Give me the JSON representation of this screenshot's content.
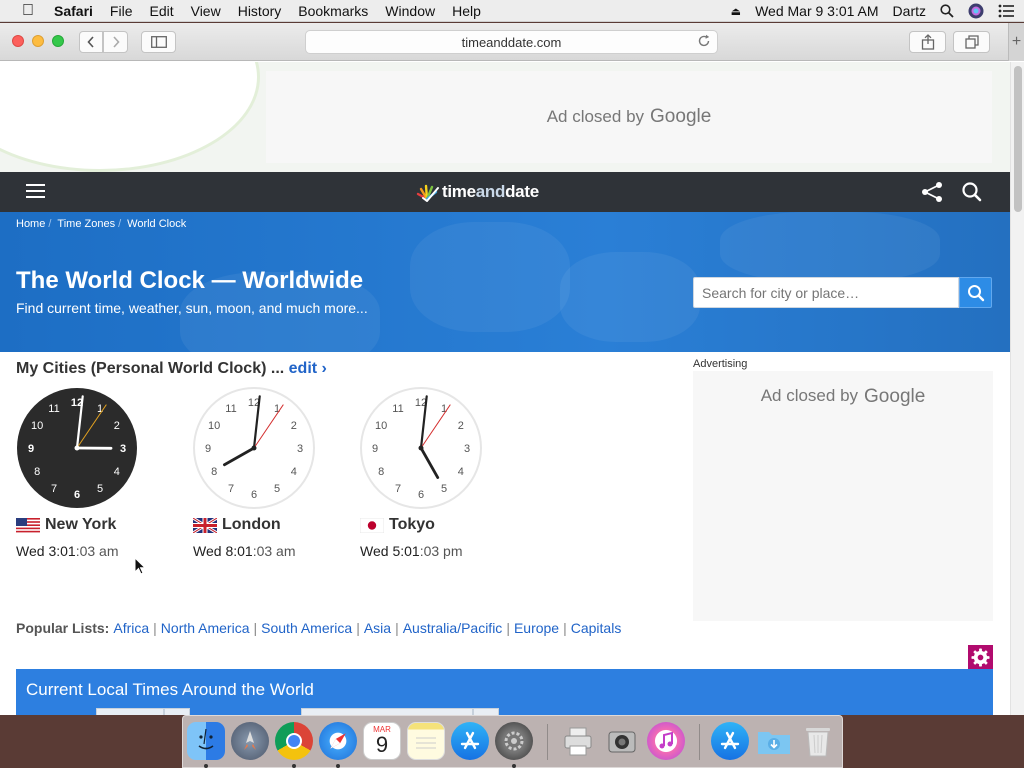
{
  "menubar": {
    "app_name": "Safari",
    "items": [
      "File",
      "Edit",
      "View",
      "History",
      "Bookmarks",
      "Window",
      "Help"
    ],
    "clock": "Wed Mar 9  3:01 AM",
    "user": "Dartz"
  },
  "browser": {
    "url": "timeanddate.com"
  },
  "top_ad": {
    "text": "Ad closed by",
    "brand": "Google"
  },
  "site": {
    "logo_left": "time",
    "logo_mid": "and",
    "logo_right": "date",
    "breadcrumbs": [
      "Home",
      "Time Zones",
      "World Clock"
    ],
    "title": "The World Clock — Worldwide",
    "subtitle": "Find current time, weather, sun, moon, and much more...",
    "search_placeholder": "Search for city or place…",
    "my_cities_label": "My Cities (Personal World Clock) ...",
    "edit_label": "edit ›",
    "cities": [
      {
        "name": "New York",
        "day": "Wed",
        "hm": "3:01",
        "sec": ":03 am",
        "hour": 3,
        "minute": 1,
        "second": 3,
        "theme": "dark"
      },
      {
        "name": "London",
        "day": "Wed",
        "hm": "8:01",
        "sec": ":03 am",
        "hour": 8,
        "minute": 1,
        "second": 3,
        "theme": "light"
      },
      {
        "name": "Tokyo",
        "day": "Wed",
        "hm": "5:01",
        "sec": ":03 pm",
        "hour": 5,
        "minute": 1,
        "second": 3,
        "theme": "light"
      }
    ],
    "ad_label": "Advertising",
    "side_ad_text": "Ad closed by",
    "side_ad_brand": "Google",
    "popular_label": "Popular Lists:",
    "popular_lists": [
      "Africa",
      "North America",
      "South America",
      "Asia",
      "Australia/Pacific",
      "Europe",
      "Capitals"
    ],
    "local_times_title": "Current Local Times Around the World"
  },
  "dock": {
    "apps": [
      "finder-icon",
      "launchpad-icon",
      "chrome-icon",
      "safari-icon",
      "calendar-icon",
      "notes-icon",
      "app-store-icon",
      "system-preferences-icon",
      "printer-utility-icon",
      "image-capture-icon",
      "itunes-icon",
      "app-store-folder-icon",
      "downloads-folder-icon",
      "trash-icon"
    ],
    "calendar_month": "MAR",
    "calendar_day": "9"
  },
  "colors": {
    "hero_blue": "#1d6ec4",
    "nav_dark": "#2f3338",
    "link_blue": "#2164c8",
    "local_times_blue": "#2d7fe0",
    "gear_magenta": "#b10b6e"
  }
}
